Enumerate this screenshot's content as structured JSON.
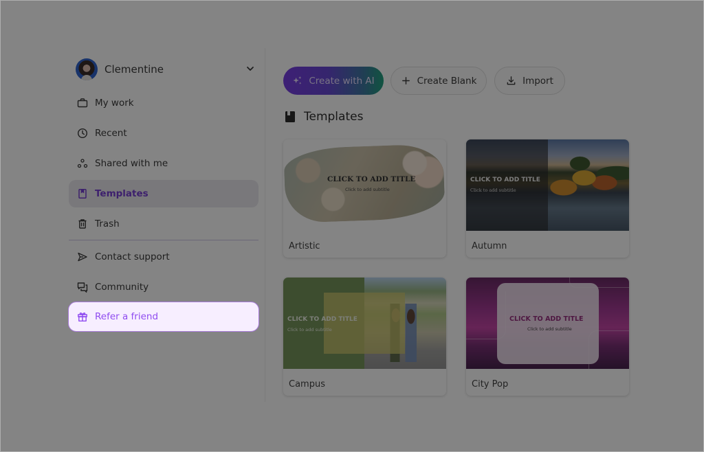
{
  "profile": {
    "name": "Clementine",
    "avatar_icon": "user-avatar",
    "menu_icon": "chevron-down-icon"
  },
  "sidebar": {
    "items": [
      {
        "label": "My work",
        "icon": "briefcase-icon"
      },
      {
        "label": "Recent",
        "icon": "clock-icon"
      },
      {
        "label": "Shared with me",
        "icon": "shared-icon"
      },
      {
        "label": "Templates",
        "icon": "bookmark-icon",
        "active": true
      },
      {
        "label": "Trash",
        "icon": "trash-icon"
      }
    ],
    "secondary_items": [
      {
        "label": "Contact support",
        "icon": "send-icon"
      },
      {
        "label": "Community",
        "icon": "chat-icon"
      },
      {
        "label": "Refer a friend",
        "icon": "gift-icon",
        "highlighted": true
      }
    ]
  },
  "toolbar": {
    "create_ai_label": "Create with AI",
    "create_blank_label": "Create Blank",
    "import_label": "Import"
  },
  "section": {
    "title": "Templates",
    "icon": "bookmark-icon"
  },
  "templates": [
    {
      "name": "Artistic",
      "thumb_title": "CLICK TO ADD TITLE",
      "thumb_subtitle": "Click to add subtitle"
    },
    {
      "name": "Autumn",
      "thumb_title": "CLICK TO ADD TITLE",
      "thumb_subtitle": "Click to add subtitle"
    },
    {
      "name": "Campus",
      "thumb_title": "CLICK TO ADD TITLE",
      "thumb_subtitle": "Click to add subtitle"
    },
    {
      "name": "City Pop",
      "thumb_title": "CLICK TO ADD TITLE",
      "thumb_subtitle": "Click to add subtitle"
    }
  ],
  "colors": {
    "accent": "#6b2fd0",
    "highlight_bg": "#f7eeff",
    "highlight_border": "#a77bd9",
    "ai_gradient_start": "#6d2ee0",
    "ai_gradient_end": "#0f9a72",
    "overlay": "#8a8a8a"
  }
}
